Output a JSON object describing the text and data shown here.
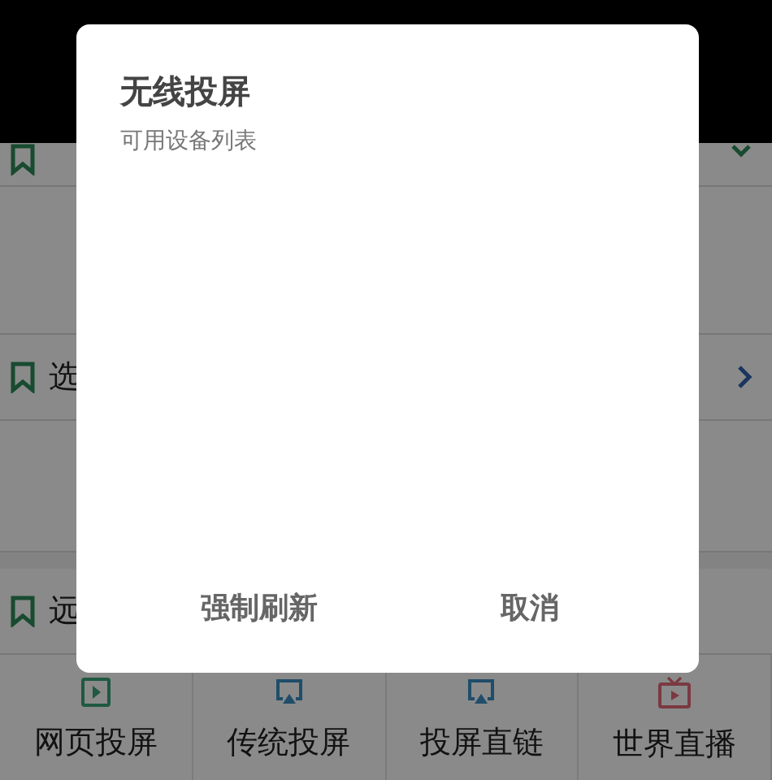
{
  "background": {
    "sections": [
      {
        "kind": "dropdown"
      },
      {
        "title": "选",
        "kind": "link"
      },
      {
        "title": "远",
        "kind": "plain"
      }
    ],
    "tiles": [
      {
        "label": "网页投屏",
        "kind": "play"
      },
      {
        "label": "传统投屏",
        "kind": "cast"
      },
      {
        "label": "投屏直链",
        "kind": "cast"
      },
      {
        "label": "世界直播",
        "kind": "tv"
      }
    ]
  },
  "dialog": {
    "title": "无线投屏",
    "subtitle": "可用设备列表",
    "buttons": [
      "强制刷新",
      "取消"
    ]
  }
}
